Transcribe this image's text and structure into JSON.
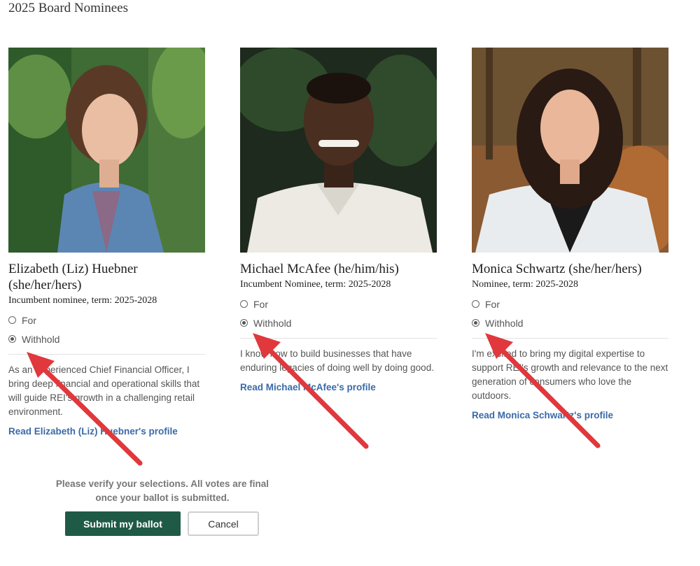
{
  "page": {
    "title": "2025 Board Nominees"
  },
  "nominees": [
    {
      "name": "Elizabeth (Liz) Huebner (she/her/hers)",
      "term": "Incumbent nominee, term: 2025-2028",
      "option_for": "For",
      "option_withhold": "Withhold",
      "selected": "Withhold",
      "bio": "As an experienced Chief Financial Officer, I bring deep financial and operational skills that will guide REI's growth in a challenging retail environment.",
      "profile_link": "Read Elizabeth (Liz) Huebner's profile"
    },
    {
      "name": "Michael McAfee (he/him/his)",
      "term": "Incumbent Nominee, term: 2025-2028",
      "option_for": "For",
      "option_withhold": "Withhold",
      "selected": "Withhold",
      "bio": "I know how to build businesses that have enduring legacies of doing well by doing good.",
      "profile_link": "Read Michael McAfee's profile"
    },
    {
      "name": "Monica Schwartz (she/her/hers)",
      "term": "Nominee, term: 2025-2028",
      "option_for": "For",
      "option_withhold": "Withhold",
      "selected": "Withhold",
      "bio": "I'm excited to bring my digital expertise to support REI's growth and relevance to the next generation of consumers who love the outdoors.",
      "profile_link": "Read Monica Schwartz's profile"
    }
  ],
  "footer": {
    "verify_text": "Please verify your selections. All votes are final once your ballot is submitted.",
    "submit_label": "Submit my ballot",
    "cancel_label": "Cancel"
  },
  "colors": {
    "submit_bg": "#1f5a47",
    "link": "#3a6aa8",
    "annotation_arrow": "#e0383c"
  }
}
